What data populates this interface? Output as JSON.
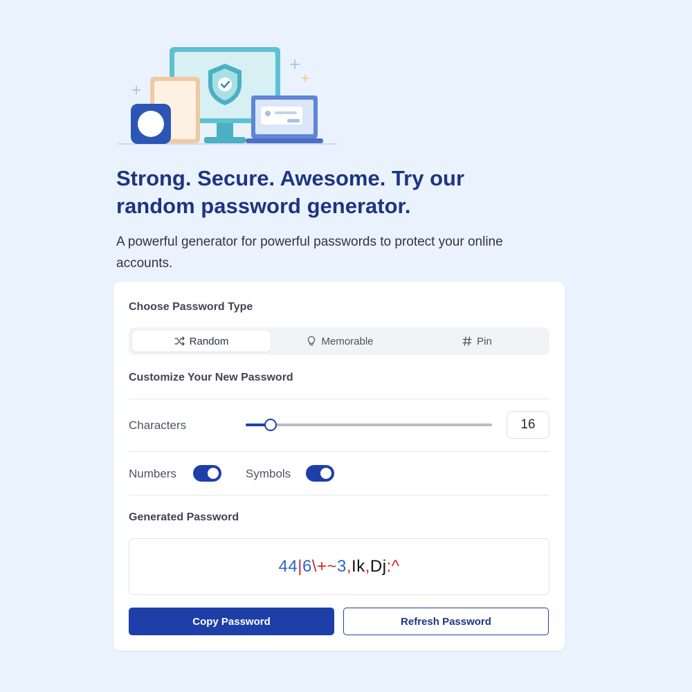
{
  "hero": {
    "headline_line1": "Strong. Secure. Awesome. Try our",
    "headline_line2": "random password generator.",
    "subtext_line1": "A powerful generator for powerful passwords to protect your online",
    "subtext_line2": "accounts."
  },
  "generator": {
    "type_label": "Choose Password Type",
    "tabs": [
      {
        "label": "Random",
        "icon": "shuffle-icon",
        "active": true
      },
      {
        "label": "Memorable",
        "icon": "lightbulb-icon",
        "active": false
      },
      {
        "label": "Pin",
        "icon": "hash-icon",
        "active": false
      }
    ],
    "customize_label": "Customize Your New Password",
    "characters_label": "Characters",
    "characters_value": "16",
    "slider_fraction": 0.1,
    "numbers_label": "Numbers",
    "numbers_enabled": true,
    "symbols_label": "Symbols",
    "symbols_enabled": true,
    "generated_label": "Generated Password",
    "password": "44|6\\+~3,Ik,Dj:^",
    "copy_button": "Copy Password",
    "refresh_button": "Refresh Password"
  },
  "colors": {
    "brand": "#1e3ea8",
    "heading": "#1d3580",
    "password_number": "#2f63c8",
    "password_symbol": "#d8232a",
    "password_letter": "#111111",
    "background": "#eaf2fe"
  }
}
